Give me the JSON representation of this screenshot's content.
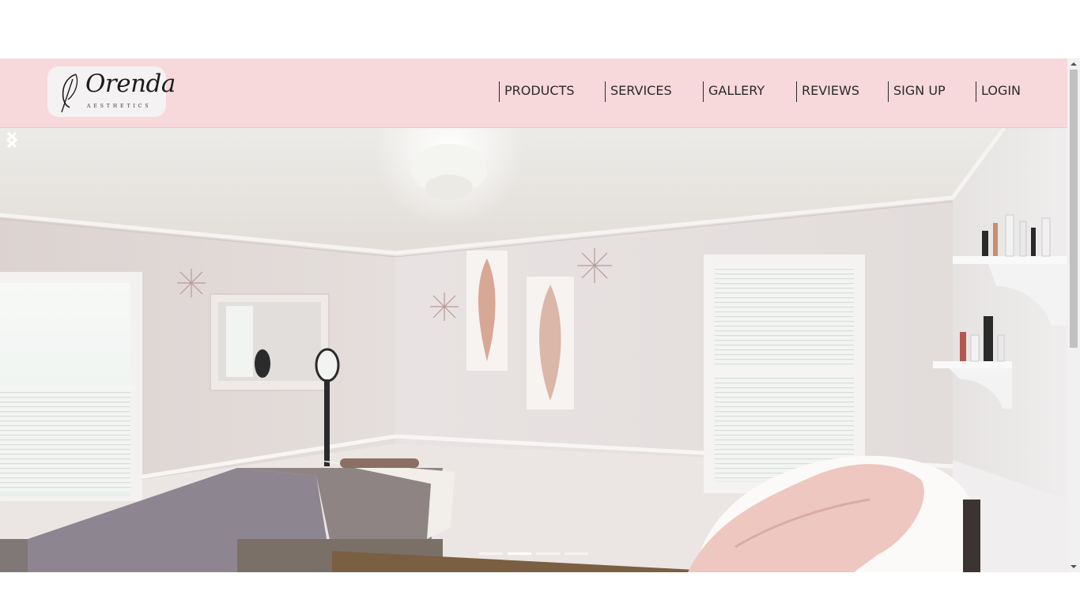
{
  "logo": {
    "name": "Orenda",
    "tagline": "AESTHETICS"
  },
  "nav": [
    {
      "label": "PRODUCTS"
    },
    {
      "label": "SERVICES"
    },
    {
      "label": "GALLERY"
    },
    {
      "label": "REVIEWS"
    },
    {
      "label": "SIGN UP"
    },
    {
      "label": "LOGIN"
    }
  ],
  "carousel": {
    "slide_count": 4,
    "active_index": 1,
    "prev_icon": "chevron-left-icon",
    "next_icon": "chevron-right-icon"
  },
  "colors": {
    "header_bg": "#f7d8db",
    "nav_text": "#2a2a2a"
  }
}
